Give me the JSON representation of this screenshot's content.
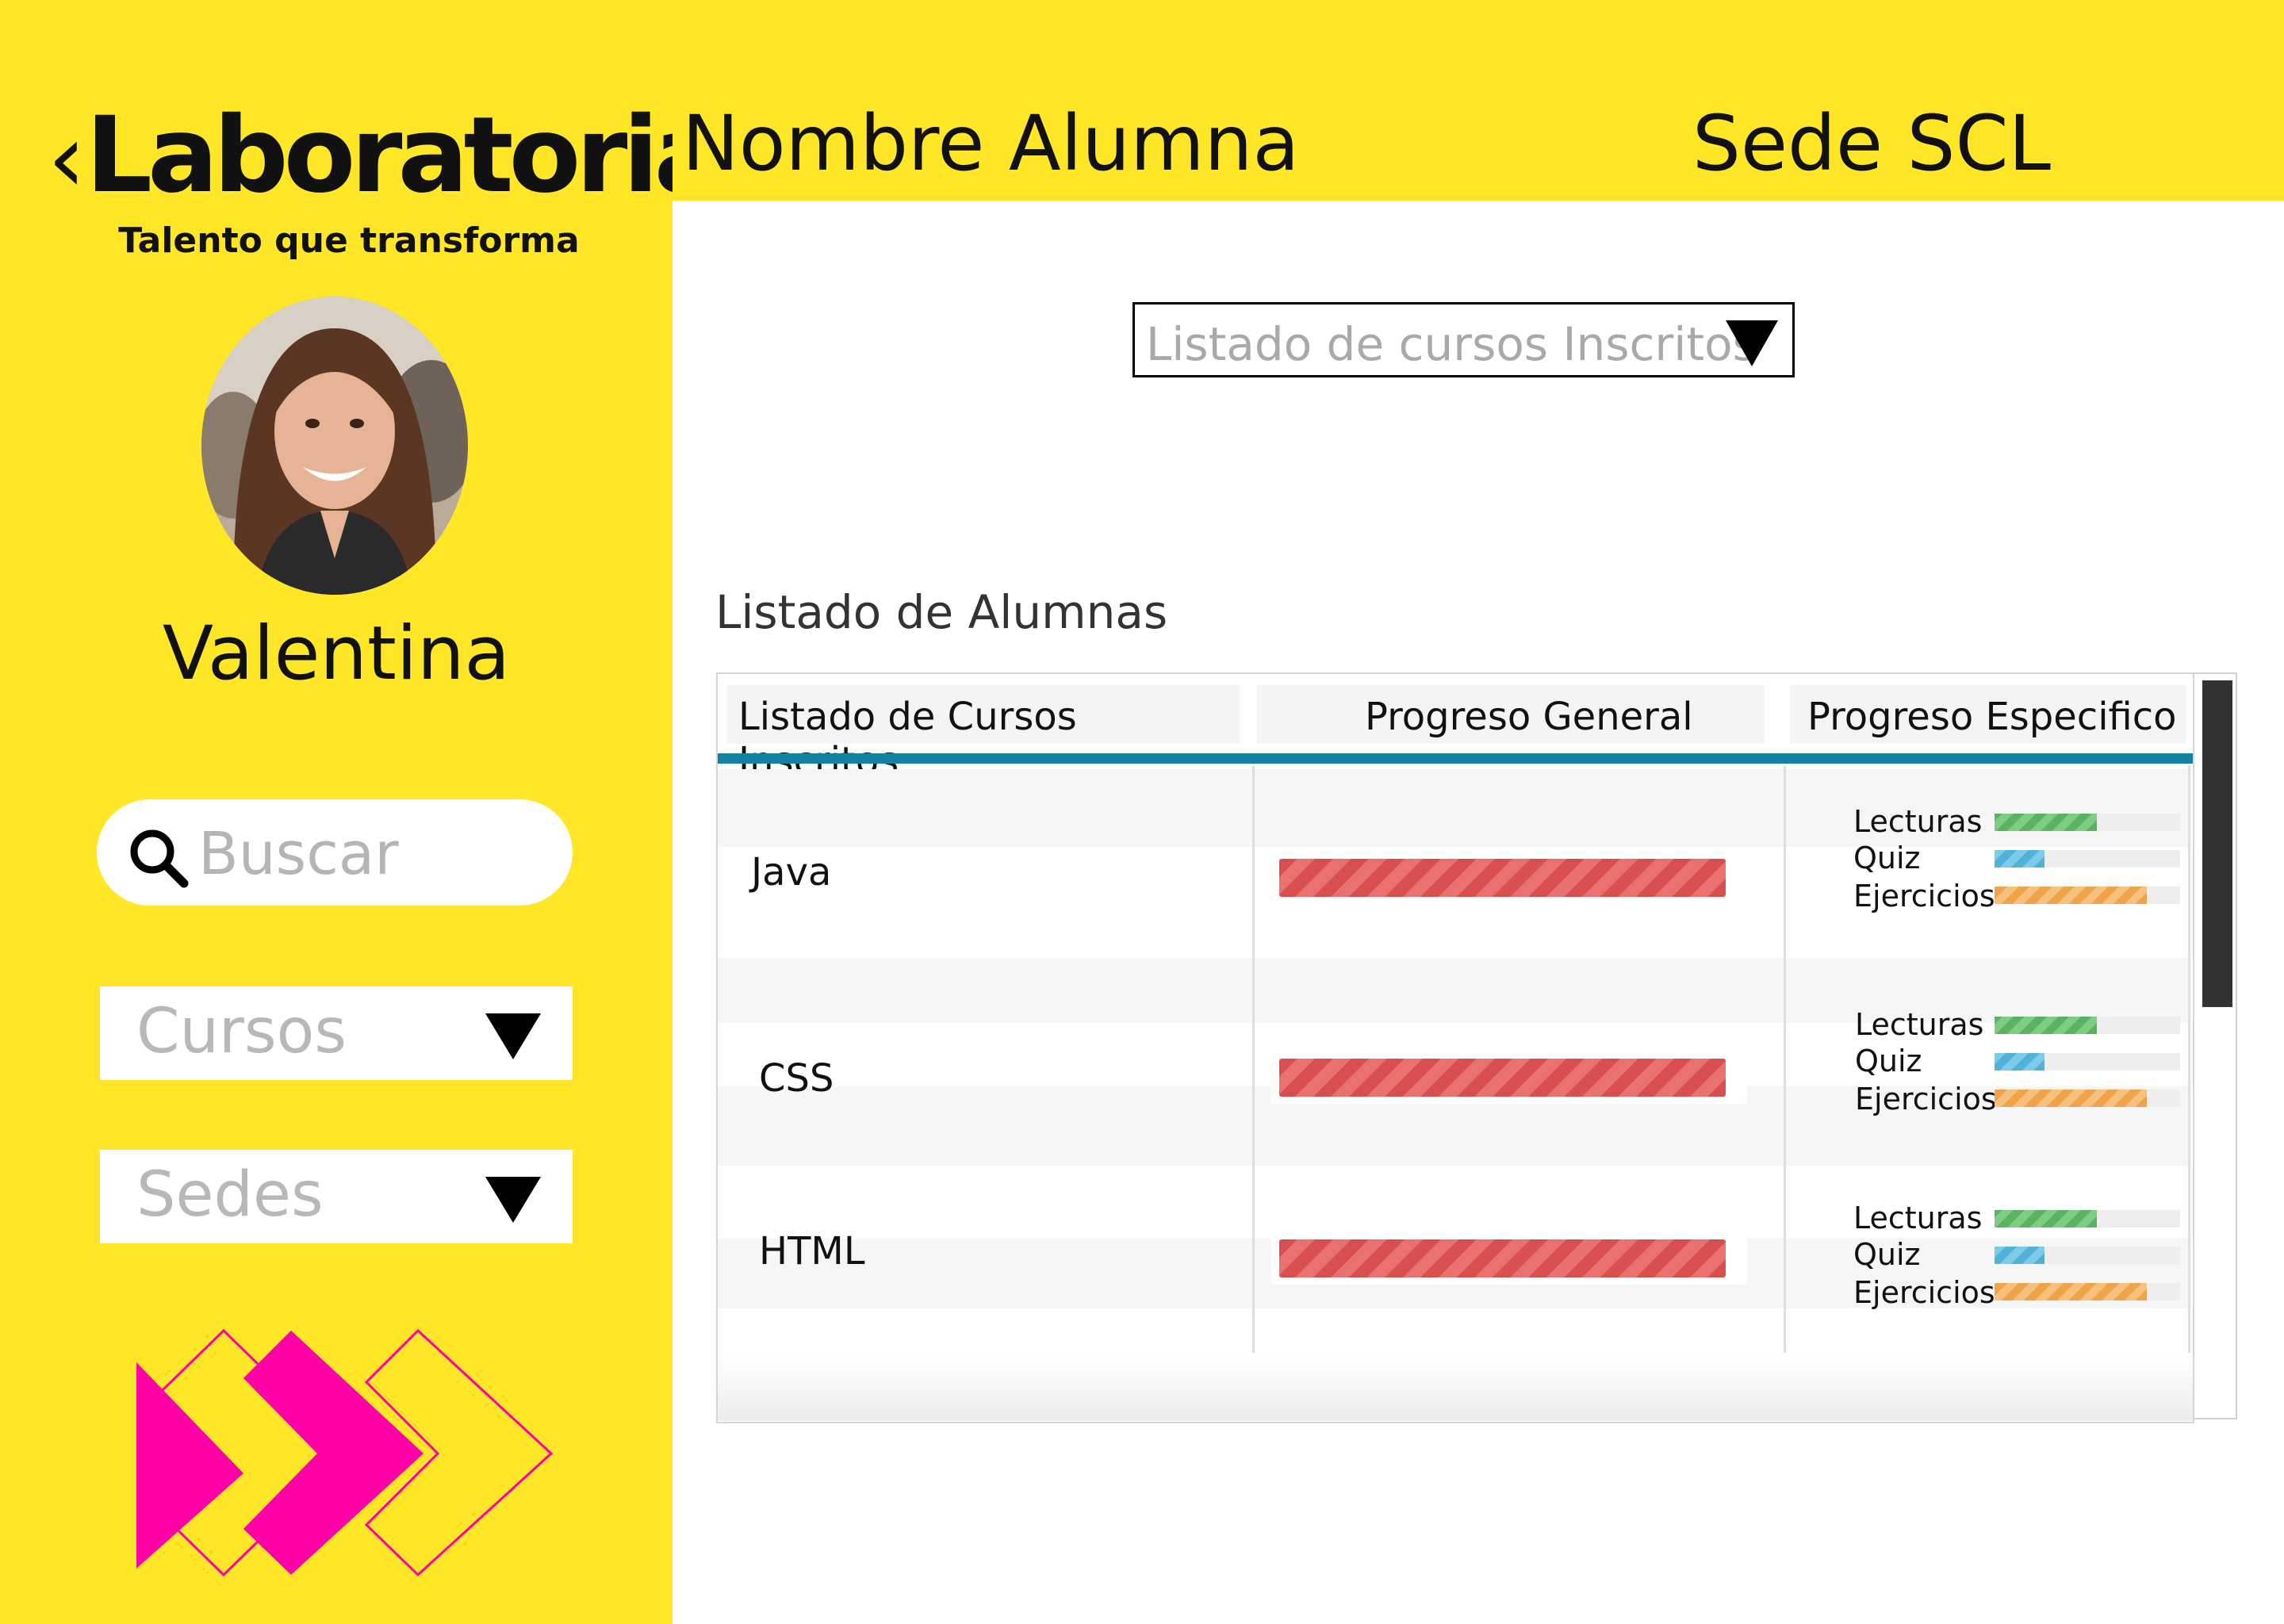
{
  "brand": {
    "logo_left": "‹",
    "logo_word": "Laboratoria",
    "logo_right": "›",
    "tagline": "Talento que transforma"
  },
  "header": {
    "student_label": "Nombre Alumna",
    "sede_label": "Sede SCL"
  },
  "sidebar": {
    "student_name": "Valentina",
    "search_placeholder": "Buscar",
    "courses_dropdown": "Cursos",
    "sedes_dropdown": "Sedes"
  },
  "main": {
    "course_select": "Listado de cursos Inscritos",
    "list_title": "Listado de Alumnas"
  },
  "table": {
    "columns": [
      "Listado de Cursos Inscritos",
      "Progreso General",
      "Progreso Especifico"
    ],
    "specific_labels": [
      "Lecturas",
      "Quiz",
      "Ejercicios"
    ],
    "rows": [
      {
        "course": "Java",
        "general": 0.97,
        "lecturas": 0.55,
        "quiz": 0.27,
        "ejercicios": 0.82
      },
      {
        "course": "CSS",
        "general": 0.97,
        "lecturas": 0.55,
        "quiz": 0.27,
        "ejercicios": 0.82
      },
      {
        "course": "HTML",
        "general": 0.97,
        "lecturas": 0.55,
        "quiz": 0.27,
        "ejercicios": 0.82
      }
    ]
  },
  "colors": {
    "brand_yellow": "#ffe627",
    "accent_magenta": "#ff00a8",
    "header_rule": "#1482a3",
    "progress_red": "#d94f4f",
    "lecturas": "#59b360",
    "quiz": "#4fb2d6",
    "ejercicios": "#f0a44a"
  },
  "icons": [
    "search-icon",
    "chevron-down-icon",
    "chevron-arrows-decoration"
  ]
}
